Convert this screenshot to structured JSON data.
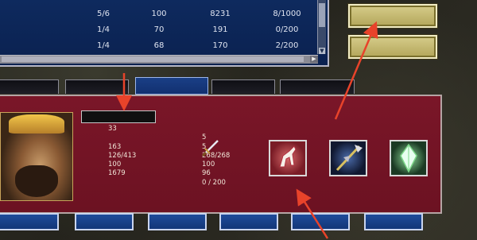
{
  "list": {
    "rows": [
      {
        "name": "",
        "a": "5/6",
        "b": "100",
        "c": "8231",
        "d": "8/1000"
      },
      {
        "name": "",
        "a": "1/4",
        "b": "70",
        "c": "191",
        "d": "0/200"
      },
      {
        "name": "",
        "a": "1/4",
        "b": "68",
        "c": "170",
        "d": "2/200"
      }
    ]
  },
  "buttons": {
    "equip": "",
    "use": ""
  },
  "tabs": [
    {
      "label": ""
    },
    {
      "label": ""
    },
    {
      "label": ""
    },
    {
      "label": ""
    },
    {
      "label": ""
    }
  ],
  "general": {
    "name": "",
    "stats_left": [
      {
        "label": "",
        "value": "33"
      },
      {
        "label": "",
        "value": ""
      },
      {
        "label": "",
        "value": "163"
      },
      {
        "label": "",
        "value": "126/413"
      },
      {
        "label": "",
        "value": "100"
      },
      {
        "label": "",
        "value": "1679"
      },
      {
        "label": "",
        "value": ""
      }
    ],
    "stats_right": [
      {
        "label": "",
        "value": ""
      },
      {
        "label": "",
        "value": "5"
      },
      {
        "label": "",
        "value": "5"
      },
      {
        "label": "",
        "value": "268/268"
      },
      {
        "label": "",
        "value": "100"
      },
      {
        "label": "",
        "value": "96"
      },
      {
        "label": "",
        "value": "0 / 200"
      }
    ]
  },
  "equipment": [
    {
      "name": "",
      "caption": ""
    },
    {
      "name": "",
      "caption": ""
    },
    {
      "name": "",
      "caption": ""
    }
  ],
  "bottom_buttons": [
    "",
    "",
    "",
    "",
    "",
    ""
  ],
  "colors": {
    "panel_maroon": "#7a1628",
    "list_blue": "#0e2a5e",
    "gold": "#d6cc8a",
    "arrow_red": "#e8432a"
  }
}
